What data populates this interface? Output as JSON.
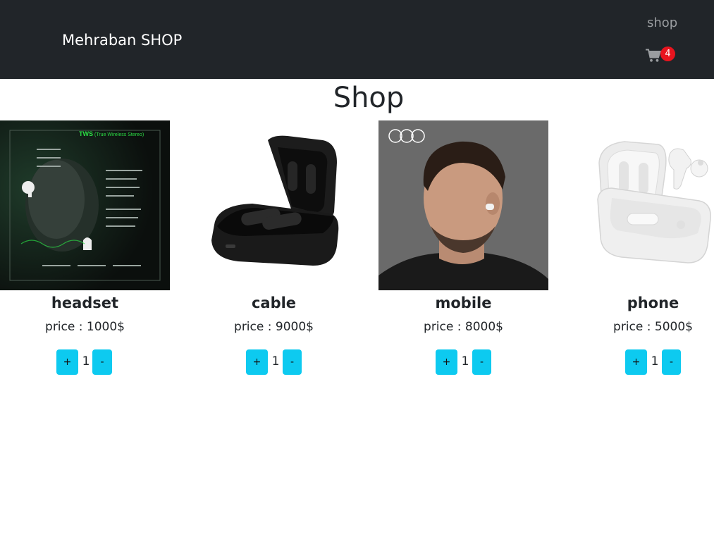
{
  "navbar": {
    "brand": "Mehraban SHOP",
    "link": "shop",
    "cart_icon": "cart-icon",
    "cart_count": "4"
  },
  "main": {
    "title": "Shop",
    "products": [
      {
        "name": "headset",
        "price": "price : 1000$",
        "quantity": "1",
        "plus": "+",
        "minus": "-",
        "image": "headset-product-image"
      },
      {
        "name": "cable",
        "price": "price : 9000$",
        "quantity": "1",
        "plus": "+",
        "minus": "-",
        "image": "earbuds-case-black-image"
      },
      {
        "name": "mobile",
        "price": "price : 8000$",
        "quantity": "1",
        "plus": "+",
        "minus": "-",
        "image": "man-with-earbud-image"
      },
      {
        "name": "phone",
        "price": "price : 5000$",
        "quantity": "1",
        "plus": "+",
        "minus": "-",
        "image": "earbuds-case-white-image"
      }
    ]
  },
  "colors": {
    "navbar_bg": "#212529",
    "button_bg": "#0dcaf0",
    "badge_bg": "#e8141e"
  }
}
